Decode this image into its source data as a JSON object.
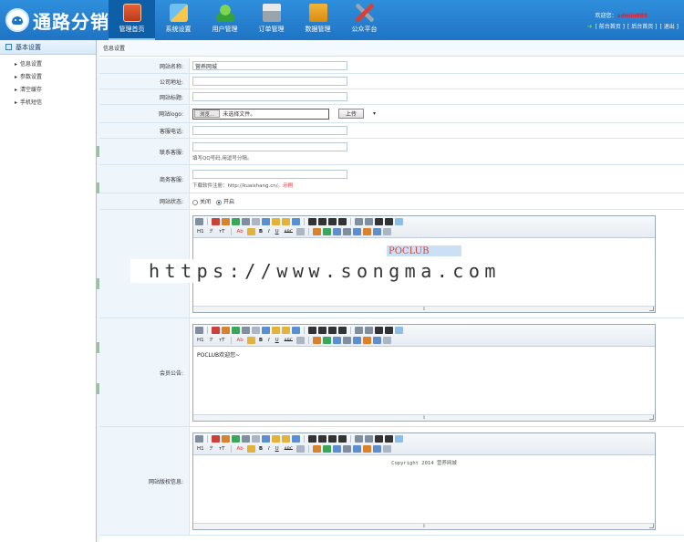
{
  "header": {
    "logo_text": "通路分销",
    "welcome_prefix": "欢迎您：",
    "username": "admin888",
    "links": [
      "[ 前台首页 ]",
      "[ 后台首页 ]",
      "[ 退出 ]"
    ]
  },
  "nav": [
    {
      "label": "管理首页",
      "icon": "book-icon"
    },
    {
      "label": "系统设置",
      "icon": "set-square-icon"
    },
    {
      "label": "用户管理",
      "icon": "users-icon"
    },
    {
      "label": "订单管理",
      "icon": "printer-icon"
    },
    {
      "label": "数据管理",
      "icon": "folder-icon"
    },
    {
      "label": "公众平台",
      "icon": "tools-icon"
    }
  ],
  "sidebar": {
    "title": "基本设置",
    "items": [
      "信息设置",
      "参数设置",
      "清空缓存",
      "手机短信"
    ]
  },
  "main": {
    "title": "信息设置",
    "fields": {
      "site_name": {
        "label": "网站名称:",
        "value": "营养网城"
      },
      "company_url": {
        "label": "公司地址:",
        "value": ""
      },
      "site_title": {
        "label": "网站标题:",
        "value": ""
      },
      "site_logo": {
        "label": "网站logo:",
        "browse": "浏览...",
        "no_file": "未选择文件。",
        "upload": "上传",
        "dropdown": "▾"
      },
      "service_phone": {
        "label": "客服电话:",
        "value": ""
      },
      "contact_qq": {
        "label": "联系客服:",
        "value": "",
        "hint": "填写QQ号码,用逗号分隔。"
      },
      "chat_service": {
        "label": "商务客服:",
        "value": "",
        "hint": "下载软件注册：http://kuaishang.cn/。",
        "hint_link": "示例"
      },
      "site_status": {
        "label": "网站状态:",
        "off": "关闭",
        "on": "开启"
      },
      "member_notice": {
        "label": "会员公告:",
        "content": "POCLUB欢迎您~"
      },
      "copyright": {
        "label": "网站版权信息:",
        "content": "Copyright 2014 营养网城"
      }
    },
    "editor_top_content": "POCLUB"
  },
  "toolbar": {
    "heading": "H1",
    "font": "ℱ",
    "size": "тT",
    "bold": "B",
    "italic": "I",
    "underline": "U",
    "strike": "ABC",
    "fontcolor": "Ab",
    "resize_glyph": "⇕"
  },
  "watermark": "https://www.songma.com"
}
